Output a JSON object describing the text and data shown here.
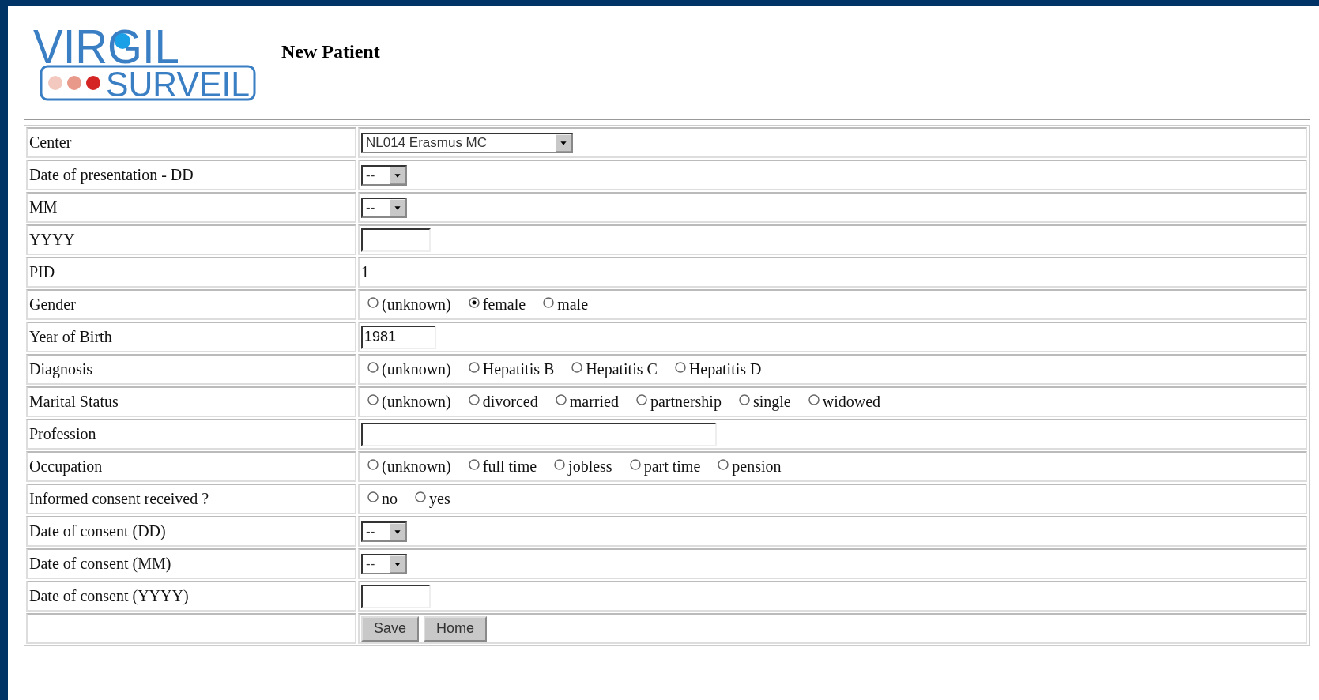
{
  "logo": {
    "line1": "VIRGIL",
    "line2": "SURVEIL"
  },
  "title": "New Patient",
  "rows": [
    {
      "label": "Center",
      "kind": "select",
      "value": "NL014 Erasmus MC"
    },
    {
      "label": "Date of presentation - DD",
      "kind": "select",
      "value": "--"
    },
    {
      "label": "MM",
      "kind": "select",
      "value": "--"
    },
    {
      "label": "YYYY",
      "kind": "input"
    },
    {
      "label": "PID",
      "kind": "static",
      "value": "1"
    },
    {
      "label": "Gender",
      "kind": "radio",
      "options": [
        {
          "label": "(unknown)",
          "selected": false
        },
        {
          "label": "female",
          "selected": true
        },
        {
          "label": "male",
          "selected": false
        }
      ]
    },
    {
      "label": "Year of Birth",
      "kind": "input",
      "value": "1981"
    },
    {
      "label": "Diagnosis",
      "kind": "radio",
      "options": [
        {
          "label": "(unknown)",
          "selected": false
        },
        {
          "label": "Hepatitis B",
          "selected": false
        },
        {
          "label": "Hepatitis C",
          "selected": false
        },
        {
          "label": "Hepatitis D",
          "selected": false
        }
      ]
    },
    {
      "label": "Marital Status",
      "kind": "radio",
      "options": [
        {
          "label": "(unknown)",
          "selected": false
        },
        {
          "label": "divorced",
          "selected": false
        },
        {
          "label": "married",
          "selected": false
        },
        {
          "label": "partnership",
          "selected": false
        },
        {
          "label": "single",
          "selected": false
        },
        {
          "label": "widowed",
          "selected": false
        }
      ]
    },
    {
      "label": "Profession",
      "kind": "input"
    },
    {
      "label": "Occupation",
      "kind": "radio",
      "options": [
        {
          "label": "(unknown)",
          "selected": false
        },
        {
          "label": "full time",
          "selected": false
        },
        {
          "label": "jobless",
          "selected": false
        },
        {
          "label": "part time",
          "selected": false
        },
        {
          "label": "pension",
          "selected": false
        }
      ]
    },
    {
      "label": "Informed consent received ?",
      "kind": "radio",
      "options": [
        {
          "label": "no",
          "selected": false
        },
        {
          "label": "yes",
          "selected": false
        }
      ]
    },
    {
      "label": "Date of consent (DD)",
      "kind": "select",
      "value": "--"
    },
    {
      "label": "Date of consent (MM)",
      "kind": "select",
      "value": "--"
    },
    {
      "label": "Date of consent (YYYY)",
      "kind": "input"
    },
    {
      "kind": "buttons",
      "buttons": [
        "Save",
        "Home"
      ]
    }
  ]
}
